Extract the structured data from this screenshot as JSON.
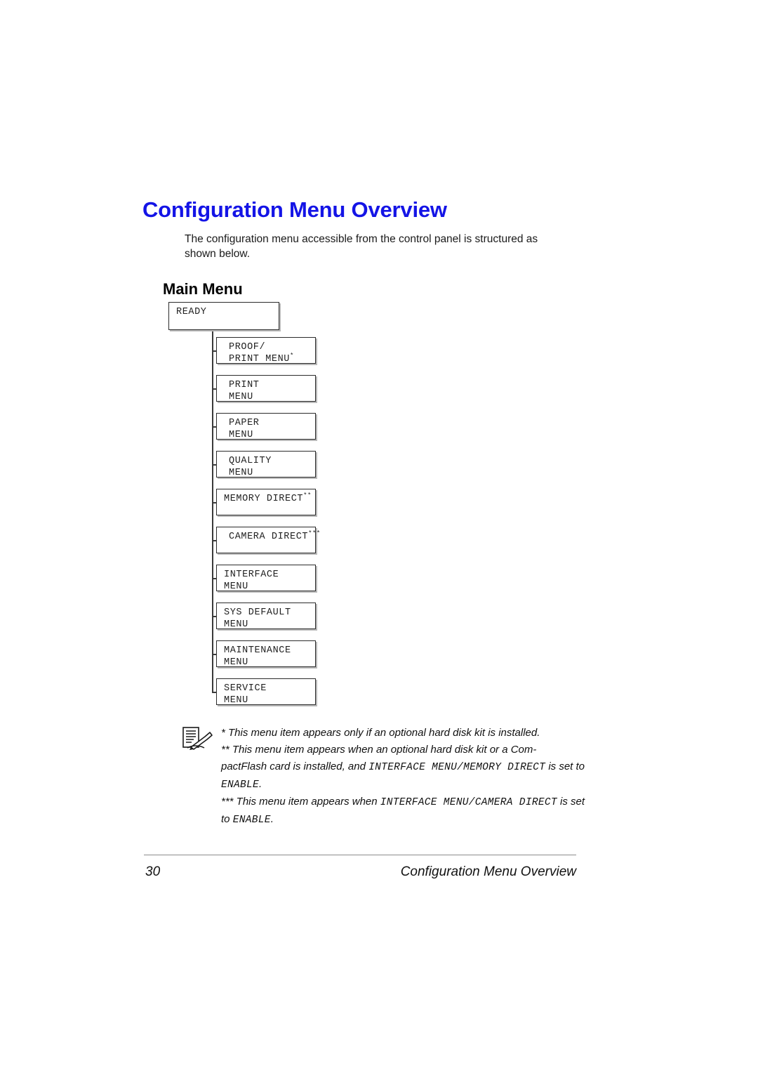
{
  "document": {
    "title": "Configuration Menu Overview",
    "intro": "The configuration menu accessible from the control panel is structured as shown below.",
    "subheading": "Main Menu"
  },
  "diagram": {
    "root": {
      "label": "READY"
    },
    "items": [
      {
        "line1": "PROOF/",
        "line2": "PRINT MENU",
        "marker": "*",
        "indent": "ind1",
        "two_line": true
      },
      {
        "line1": "PRINT",
        "line2": "MENU",
        "marker": "",
        "indent": "ind1",
        "two_line": true
      },
      {
        "line1": "PAPER",
        "line2": "MENU",
        "marker": "",
        "indent": "ind1",
        "two_line": true
      },
      {
        "line1": "QUALITY",
        "line2": "MENU",
        "marker": "",
        "indent": "ind1",
        "two_line": true
      },
      {
        "line1": "MEMORY DIRECT",
        "line2": "",
        "marker": "**",
        "indent": "ind0",
        "two_line": false
      },
      {
        "line1": "CAMERA DIRECT",
        "line2": "",
        "marker": "***",
        "indent": "ind1",
        "two_line": false
      },
      {
        "line1": "INTERFACE",
        "line2": "MENU",
        "marker": "",
        "indent": "ind0",
        "two_line": true
      },
      {
        "line1": "SYS DEFAULT",
        "line2": "MENU",
        "marker": "",
        "indent": "ind0",
        "two_line": true
      },
      {
        "line1": "MAINTENANCE",
        "line2": "MENU",
        "marker": "",
        "indent": "ind0",
        "two_line": true
      },
      {
        "line1": "SERVICE",
        "line2": "MENU",
        "marker": "",
        "indent": "ind0",
        "two_line": true
      }
    ]
  },
  "note": {
    "icon": "note-pencil-icon",
    "line1": "* This menu item appears only if an optional hard disk kit is installed.",
    "line2": "** This menu item appears when an optional hard disk kit or a Com-",
    "line3_plain": "pactFlash card is installed, and ",
    "line3_mono": "INTERFACE MENU/MEMORY DIRECT",
    "line3_plain2": " is set to ",
    "line3_mono2": "ENABLE",
    "line3_end": ".",
    "line4_plain": "*** This menu item appears when ",
    "line4_mono": "INTERFACE MENU/CAMERA DIRECT",
    "line4_plain2": " is set to ",
    "line4_mono2": "ENABLE",
    "line4_end": "."
  },
  "footer": {
    "page_number": "30",
    "section_title": "Configuration Menu Overview"
  },
  "colors": {
    "title_blue": "#1414e6",
    "box_border": "#2b2b2b",
    "box_shadow": "#b9b9b9",
    "rule_gray": "#8c8c8c"
  }
}
